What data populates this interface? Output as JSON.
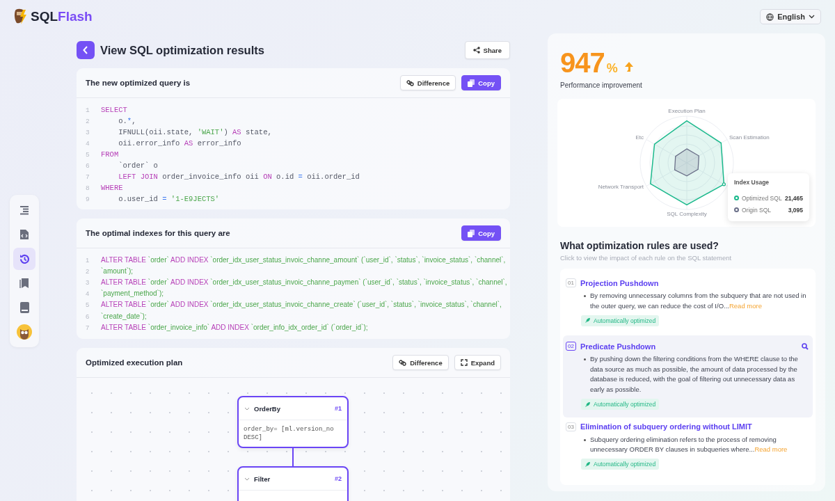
{
  "brand": {
    "name_dark": "SQL",
    "name_accent": "Flash"
  },
  "language": {
    "label": "English"
  },
  "sidebar": {
    "items": [
      {
        "kind": "outline",
        "selected": false
      },
      {
        "kind": "file",
        "selected": false
      },
      {
        "kind": "history",
        "selected": true
      },
      {
        "kind": "bookmarks",
        "selected": false
      },
      {
        "kind": "book",
        "selected": false
      },
      {
        "kind": "avatar",
        "selected": false
      }
    ]
  },
  "page": {
    "title": "View SQL optimization results",
    "share": "Share"
  },
  "query_card": {
    "title": "The new optimized query is",
    "buttons": [
      "Difference",
      "Copy"
    ],
    "lines": [
      {
        "n": "1",
        "indent": false,
        "t": [
          {
            "kind": "kw",
            "text": "SELECT"
          }
        ]
      },
      {
        "n": "2",
        "indent": true,
        "t": [
          {
            "kind": "plain",
            "text": "o."
          },
          {
            "kind": "op",
            "text": "*"
          },
          {
            "kind": "plain",
            "text": ","
          }
        ]
      },
      {
        "n": "3",
        "indent": true,
        "t": [
          {
            "kind": "plain",
            "text": "IFNULL(oii.state, "
          },
          {
            "kind": "str",
            "text": "'WAIT'"
          },
          {
            "kind": "plain",
            "text": ") "
          },
          {
            "kind": "kw",
            "text": "AS"
          },
          {
            "kind": "plain",
            "text": " state,"
          }
        ]
      },
      {
        "n": "4",
        "indent": true,
        "t": [
          {
            "kind": "plain",
            "text": "oii.error_info "
          },
          {
            "kind": "kw",
            "text": "AS"
          },
          {
            "kind": "plain",
            "text": " error_info"
          }
        ]
      },
      {
        "n": "5",
        "indent": false,
        "t": [
          {
            "kind": "kw",
            "text": "FROM"
          }
        ]
      },
      {
        "n": "6",
        "indent": true,
        "t": [
          {
            "kind": "plain",
            "text": "`order` o"
          }
        ]
      },
      {
        "n": "7",
        "indent": true,
        "t": [
          {
            "kind": "kw",
            "text": "LEFT JOIN"
          },
          {
            "kind": "plain",
            "text": " order_invoice_info oii "
          },
          {
            "kind": "kw",
            "text": "ON"
          },
          {
            "kind": "plain",
            "text": " o.id "
          },
          {
            "kind": "op",
            "text": "="
          },
          {
            "kind": "plain",
            "text": " oii.order_id"
          }
        ]
      },
      {
        "n": "8",
        "indent": false,
        "t": [
          {
            "kind": "kw",
            "text": "WHERE"
          }
        ]
      },
      {
        "n": "9",
        "indent": true,
        "t": [
          {
            "kind": "plain",
            "text": "o.user_id "
          },
          {
            "kind": "op",
            "text": "="
          },
          {
            "kind": "str",
            "text": " '1-E9JECTS'"
          }
        ]
      }
    ]
  },
  "index_card": {
    "title": "The optimal indexes for this query are",
    "buttons": [
      "Copy"
    ],
    "lines": [
      {
        "n": "1",
        "t": [
          {
            "kind": "kw",
            "text": "ALTER TABLE"
          },
          {
            "kind": "str",
            "text": " `order` "
          },
          {
            "kind": "kw",
            "text": "ADD INDEX"
          },
          {
            "kind": "str",
            "text": " `order_idx_user_status_invoic_channe_amount` (`user_id`, `status`, `invoice_status`, `channel`,"
          }
        ]
      },
      {
        "n": "2",
        "t": [
          {
            "kind": "str",
            "text": "`amount`);"
          }
        ]
      },
      {
        "n": "3",
        "t": [
          {
            "kind": "kw",
            "text": "ALTER TABLE"
          },
          {
            "kind": "str",
            "text": " `order` "
          },
          {
            "kind": "kw",
            "text": "ADD INDEX"
          },
          {
            "kind": "str",
            "text": " `order_idx_user_status_invoic_channe_paymen` (`user_id`, `status`, `invoice_status`, `channel`,"
          }
        ]
      },
      {
        "n": "4",
        "t": [
          {
            "kind": "str",
            "text": "`payment_method`);"
          }
        ]
      },
      {
        "n": "5",
        "t": [
          {
            "kind": "kw",
            "text": "ALTER TABLE"
          },
          {
            "kind": "str",
            "text": " `order` "
          },
          {
            "kind": "kw",
            "text": "ADD INDEX"
          },
          {
            "kind": "str",
            "text": " `order_idx_user_status_invoic_channe_create` (`user_id`, `status`, `invoice_status`, `channel`,"
          }
        ]
      },
      {
        "n": "6",
        "t": [
          {
            "kind": "str",
            "text": "`create_date`);"
          }
        ]
      },
      {
        "n": "7",
        "t": [
          {
            "kind": "kw",
            "text": "ALTER TABLE"
          },
          {
            "kind": "str",
            "text": " `order_invoice_info` "
          },
          {
            "kind": "kw",
            "text": "ADD INDEX"
          },
          {
            "kind": "str",
            "text": " `order_info_idx_order_id` (`order_id`);"
          }
        ]
      }
    ]
  },
  "plan_card": {
    "title": "Optimized execution plan",
    "buttons": [
      "Difference",
      "Expand"
    ],
    "nodes": [
      {
        "name": "OrderBy",
        "number": "#1",
        "detail": "order_by= [ml.version_no DESC]"
      },
      {
        "name": "Filter",
        "number": "#2"
      }
    ]
  },
  "performance": {
    "value": "947",
    "unit": "%",
    "label": "Performance improvement"
  },
  "radar": {
    "axes": [
      "Execution Plan",
      "Etc",
      "Scan Estimation",
      "Network Transport",
      "SQL Complexity"
    ],
    "tooltip": {
      "title": "Index Usage",
      "series": [
        {
          "name": "Optimized SQL",
          "value": "21,465",
          "color": "#1bb98c"
        },
        {
          "name": "Origin SQL",
          "value": "3,095",
          "color": "#6b7089"
        }
      ]
    }
  },
  "rules": {
    "title": "What optimization rules are used?",
    "subtitle": "Click to view the impact of each rule on the SQL statement",
    "items": [
      {
        "number": "01",
        "title": "Projection Pushdown",
        "description": "By removing unnecessary columns from the subquery that are not used in the outer query, we can reduce the cost of I/O...",
        "read_more": "Read more",
        "badge": "Automatically optimized",
        "selected": false
      },
      {
        "number": "02",
        "title": "Predicate Pushdown",
        "description": "By pushing down the filtering conditions from the WHERE clause to the data source as much as possible, the amount of data processed by the database is reduced, with the goal of filtering out unnecessary data as early as possible.",
        "badge": "Automatically optimized",
        "selected": true
      },
      {
        "number": "03",
        "title": "Elimination of subquery ordering without LIMIT",
        "description": "Subquery ordering elimination refers to the process of removing unnecessary ORDER BY clauses in subqueries where...",
        "read_more": "Read more",
        "badge": "Automatically optimized",
        "selected": false
      }
    ]
  }
}
